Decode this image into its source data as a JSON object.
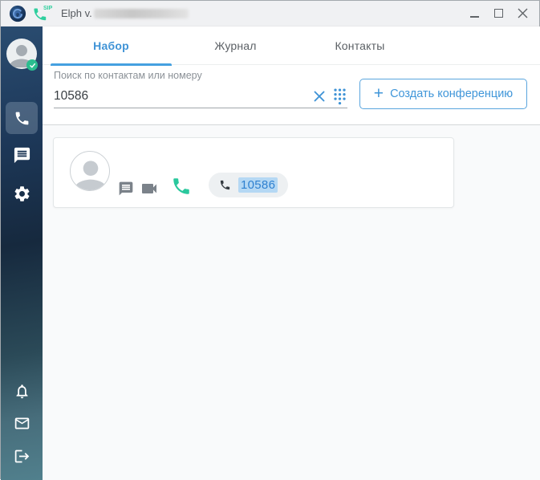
{
  "window": {
    "title_prefix": "Elph v.",
    "sip_label": "SIP"
  },
  "icons": {
    "plus": "+",
    "minimize": "minimize-icon",
    "maximize": "maximize-icon",
    "close": "close-icon",
    "clear": "close-icon",
    "dialpad": "dialpad-icon"
  },
  "sidebar": {
    "top_items": [
      "user-avatar",
      "phone",
      "chats",
      "settings"
    ],
    "bottom_items": [
      "notifications",
      "mail",
      "logout"
    ],
    "active_item": "phone",
    "avatar_status": "online"
  },
  "tabs": [
    {
      "label": "Набор",
      "active": true
    },
    {
      "label": "Журнал",
      "active": false
    },
    {
      "label": "Контакты",
      "active": false
    }
  ],
  "search": {
    "label": "Поиск по контактам или номеру",
    "value": "10586"
  },
  "conference_button": {
    "label": "Создать конференцию"
  },
  "contact_card": {
    "number": "10586",
    "actions": [
      "chat",
      "video-call",
      "call"
    ]
  },
  "colors": {
    "accent_blue": "#3f93d6",
    "green": "#2ac89d",
    "sidebar_top": "#2a4c70",
    "sidebar_bottom": "#51808d",
    "titlebar_bg": "#f0f1f3",
    "content_bg": "#f9fafb",
    "chip_bg": "#edf0f2",
    "selection_bg": "#b5d8f4"
  }
}
